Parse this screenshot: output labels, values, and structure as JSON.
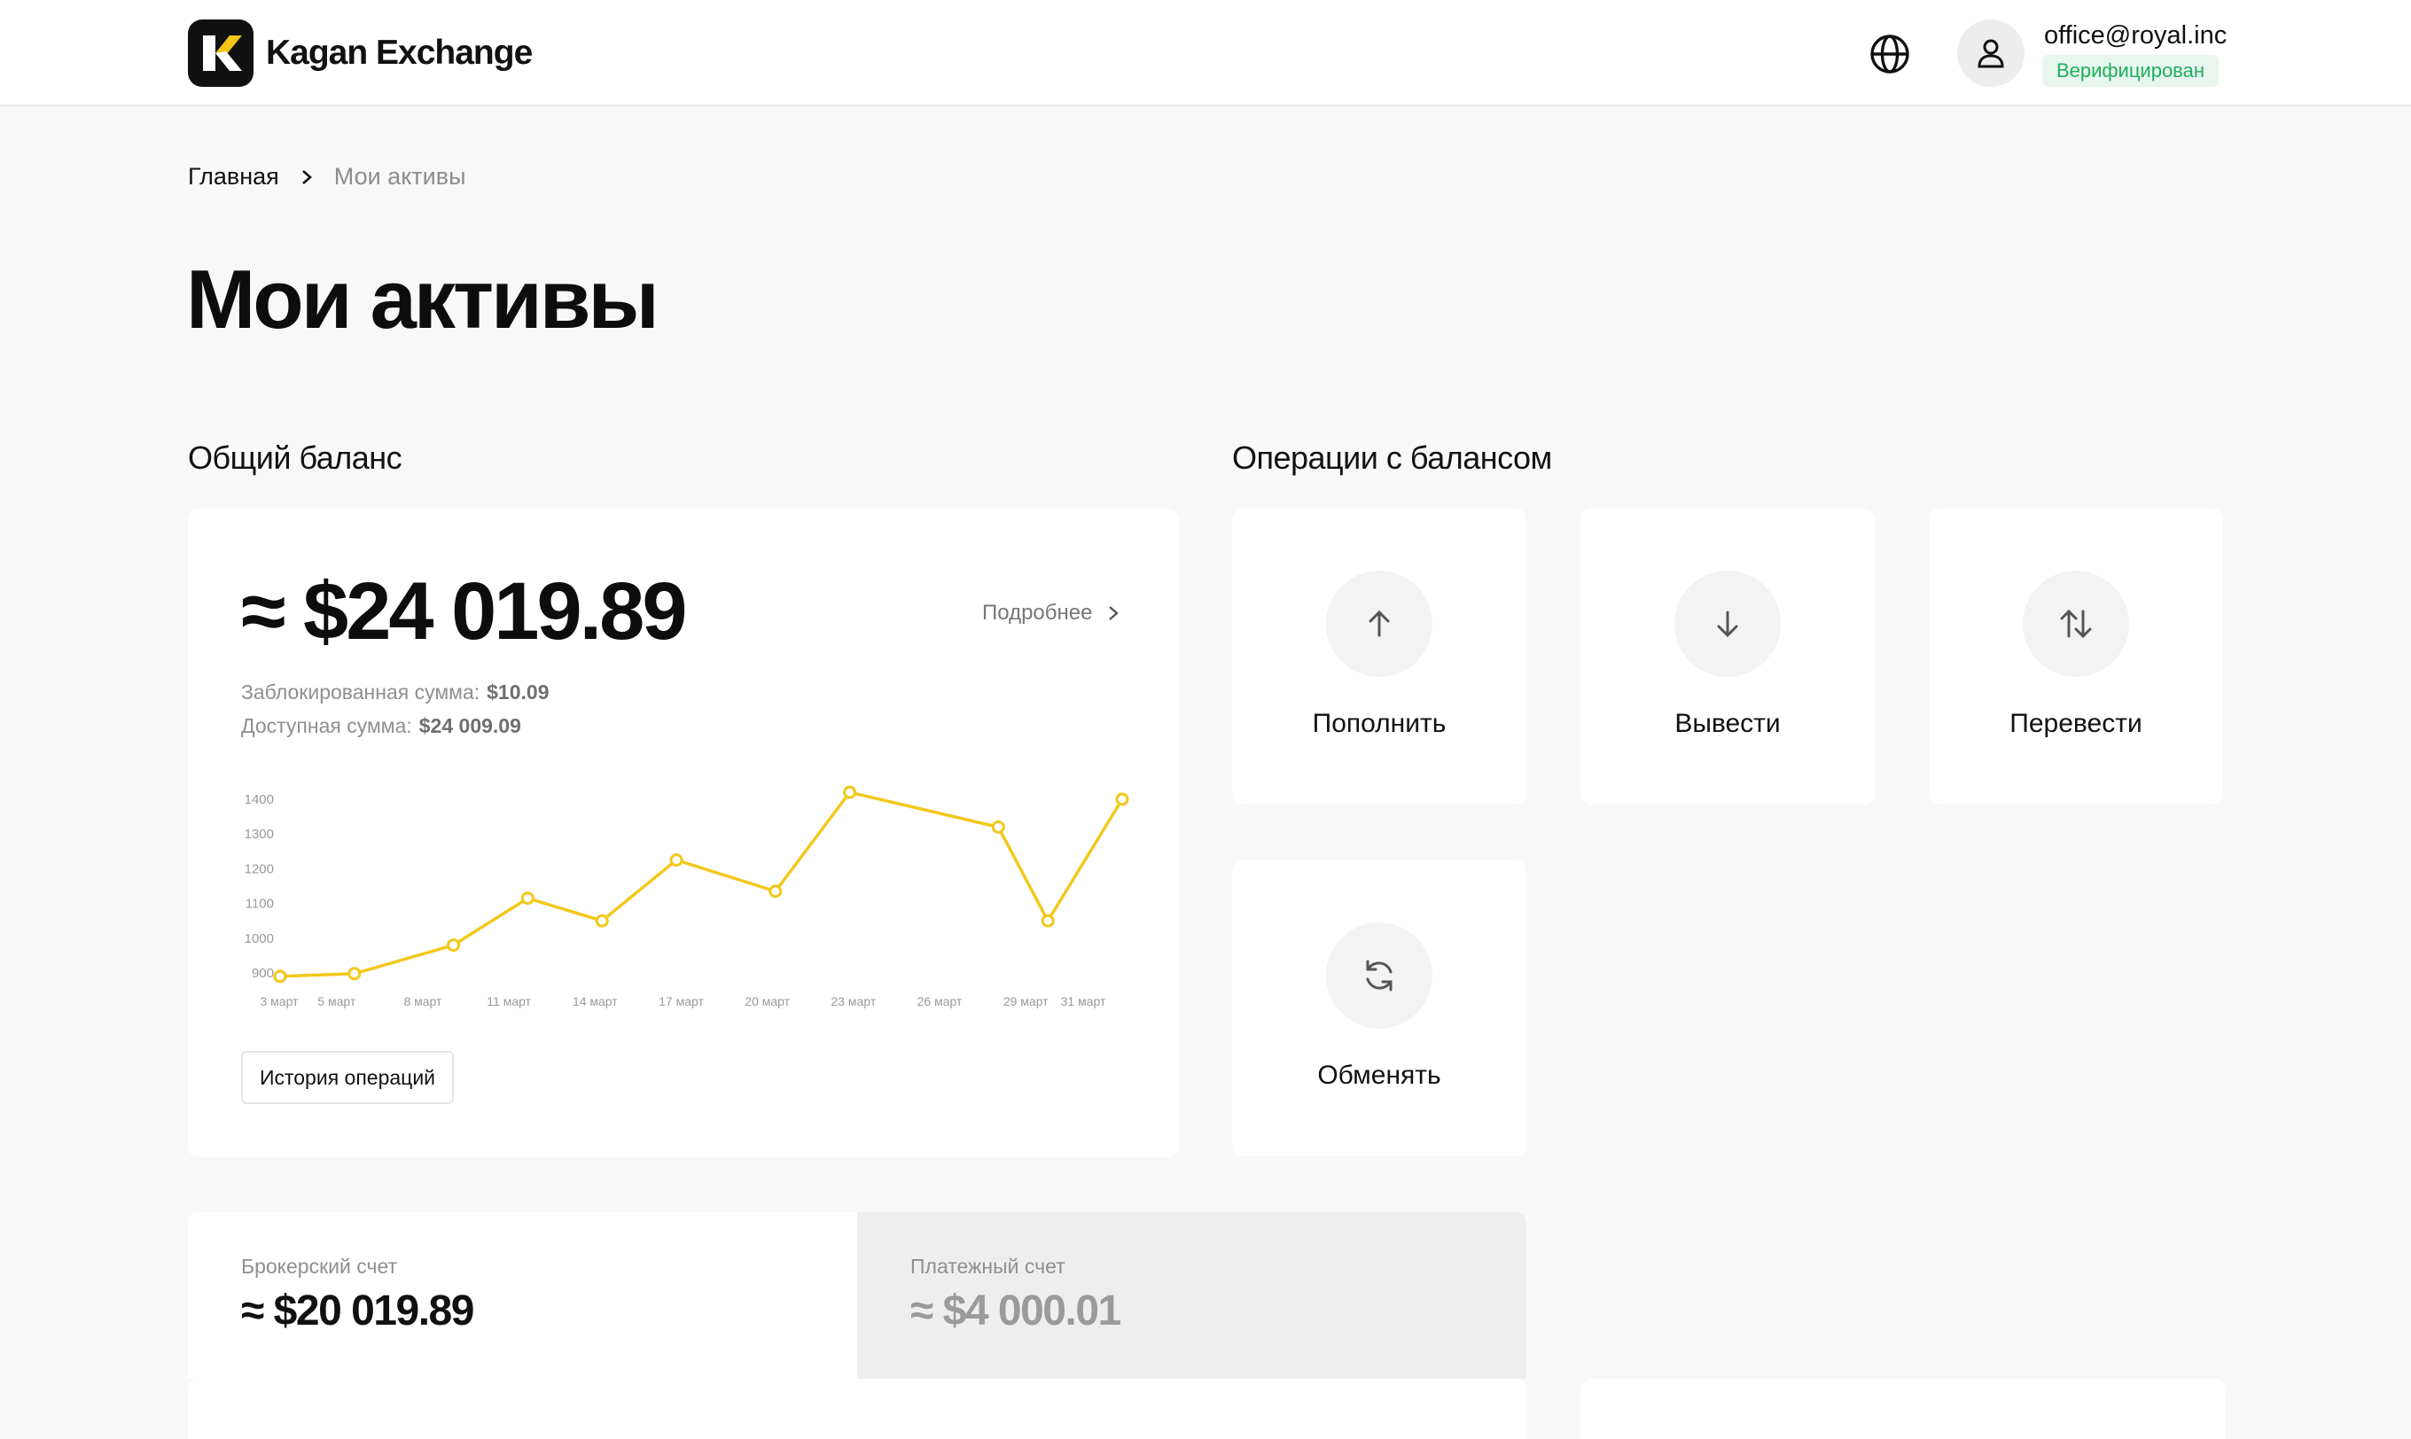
{
  "header": {
    "brand": "Kagan Exchange",
    "user_email": "office@royal.inc",
    "verified_label": "Верифицирован"
  },
  "breadcrumb": {
    "home": "Главная",
    "current": "Мои активы"
  },
  "page_title": "Мои активы",
  "balance": {
    "section_title": "Общий баланс",
    "total": "≈ $24 019.89",
    "more_label": "Подробнее",
    "blocked_label": "Заблокированная сумма:",
    "blocked_value": "$10.09",
    "available_label": "Доступная сумма:",
    "available_value": "$24 009.09",
    "history_button": "История операций"
  },
  "chart_data": {
    "type": "line",
    "color": "#f2c81c",
    "ylim": [
      900,
      1400
    ],
    "yticks": [
      900,
      1000,
      1100,
      1200,
      1300,
      1400
    ],
    "categories": [
      "3 март",
      "5 март",
      "8 март",
      "11 март",
      "14 март",
      "17 март",
      "20 март",
      "23 март",
      "26 март",
      "29 март",
      "31 март"
    ],
    "x": [
      3,
      5,
      8,
      11,
      14,
      17,
      20,
      23,
      26,
      29,
      31
    ],
    "points": [
      {
        "x": 3,
        "y": 890
      },
      {
        "x": 6,
        "y": 898
      },
      {
        "x": 10,
        "y": 980
      },
      {
        "x": 13,
        "y": 1115
      },
      {
        "x": 16,
        "y": 1050
      },
      {
        "x": 19,
        "y": 1225
      },
      {
        "x": 23,
        "y": 1135
      },
      {
        "x": 26,
        "y": 1420
      },
      {
        "x": 32,
        "y": 1320
      },
      {
        "x": 34,
        "y": 1050
      },
      {
        "x": 37,
        "y": 1400
      }
    ]
  },
  "operations": {
    "section_title": "Операции с балансом",
    "deposit": "Пополнить",
    "withdraw": "Вывести",
    "transfer": "Перевести",
    "exchange": "Обменять"
  },
  "accounts": {
    "broker_label": "Брокерский счет",
    "broker_amount": "≈ $20 019.89",
    "payment_label": "Платежный счет",
    "payment_amount": "≈ $4 000.01"
  }
}
